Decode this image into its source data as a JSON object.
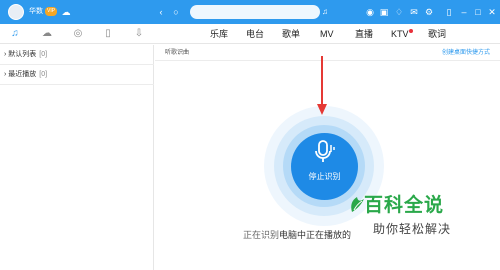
{
  "titlebar": {
    "username": "华数",
    "vip_badge": "VIP",
    "search": {
      "placeholder": ""
    }
  },
  "sidebar_tabs": [
    {
      "icon": "music-note-icon",
      "active": true
    },
    {
      "icon": "cloud-icon",
      "active": false
    },
    {
      "icon": "radio-icon",
      "active": false
    },
    {
      "icon": "phone-icon",
      "active": false
    },
    {
      "icon": "download-icon",
      "active": false
    }
  ],
  "nav_tabs": [
    "乐库",
    "电台",
    "歌单",
    "MV",
    "直播",
    "KTV",
    "歌词"
  ],
  "playlists": [
    {
      "label": "默认列表",
      "count": "[0]"
    },
    {
      "label": "最近播放",
      "count": "[0]"
    }
  ],
  "main": {
    "title": "听歌识曲",
    "shortcut_link": "创建桌面快捷方式",
    "stop_button_label": "停止识别",
    "status_prefix": "正在识别",
    "status_strong": "电脑中正在播放的"
  },
  "watermark": {
    "title": "百科全说",
    "subtitle": "助你轻松解决"
  },
  "colors": {
    "brand": "#2e9aee",
    "button": "#1e8ae6",
    "annotation_arrow": "#e53935",
    "ktv_dot": "#e8303a",
    "watermark_green": "#2aa84a"
  }
}
